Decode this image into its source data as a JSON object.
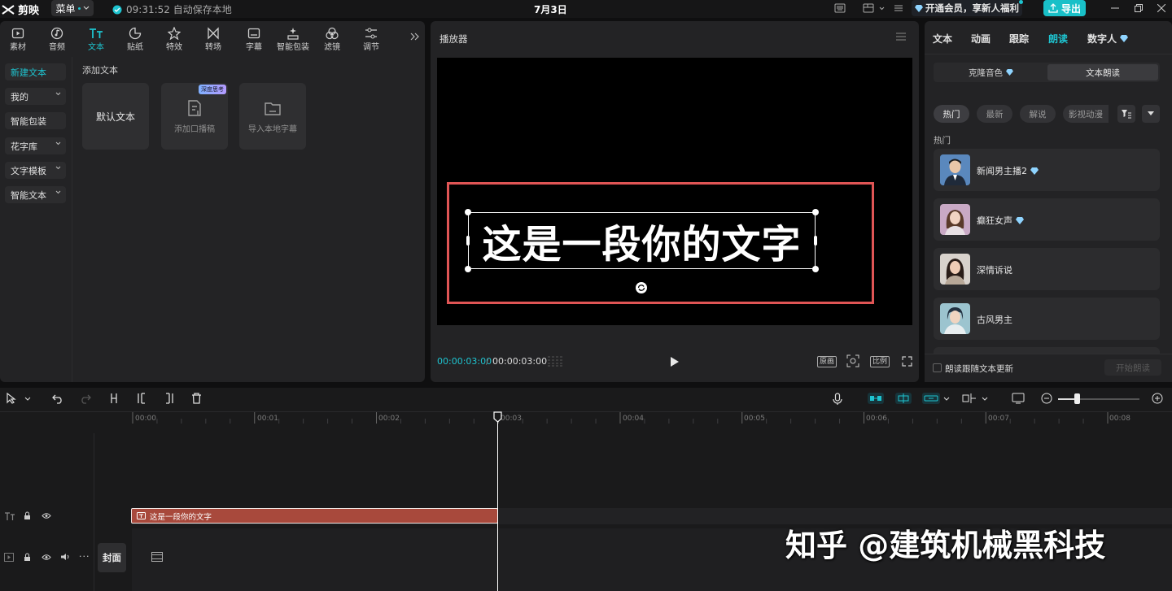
{
  "titlebar": {
    "app": "剪映",
    "menu": "菜单",
    "autosave": "09:31:52 自动保存本地",
    "date": "7月3日",
    "vip": "开通会员，享新人福利",
    "export": "导出"
  },
  "toolbar": {
    "tabs": [
      {
        "label": "素材",
        "icon": "media-icon"
      },
      {
        "label": "音频",
        "icon": "audio-icon"
      },
      {
        "label": "文本",
        "icon": "text-icon"
      },
      {
        "label": "贴纸",
        "icon": "sticker-icon"
      },
      {
        "label": "特效",
        "icon": "effects-icon"
      },
      {
        "label": "转场",
        "icon": "transition-icon"
      },
      {
        "label": "字幕",
        "icon": "subtitle-icon"
      },
      {
        "label": "智能包装",
        "icon": "smart-pack-icon"
      },
      {
        "label": "滤镜",
        "icon": "filter-icon"
      },
      {
        "label": "调节",
        "icon": "adjust-icon"
      }
    ]
  },
  "leftnav": {
    "items": [
      "新建文本",
      "我的",
      "智能包装",
      "花字库",
      "文字模板",
      "智能文本"
    ]
  },
  "textpanel": {
    "heading": "添加文本",
    "cards": [
      "默认文本",
      "添加口播稿",
      "导入本地字幕"
    ],
    "badge": "深度思考"
  },
  "player": {
    "title": "播放器",
    "overlay_text": "这是一段你的文字",
    "time_current": "00:00:03:00",
    "time_total": "00:00:03:00",
    "btn_original": "原画",
    "btn_ratio": "比例"
  },
  "rightpanel": {
    "tabs": [
      "文本",
      "动画",
      "跟踪",
      "朗读",
      "数字人"
    ],
    "active_tab": "朗读",
    "subtabs": [
      "克隆音色",
      "文本朗读"
    ],
    "chips": [
      "热门",
      "最新",
      "解说",
      "影视动漫"
    ],
    "section": "热门",
    "voices": [
      {
        "name": "新闻男主播2",
        "vip": true
      },
      {
        "name": "癫狂女声",
        "vip": true
      },
      {
        "name": "深情诉说",
        "vip": false
      },
      {
        "name": "古风男主",
        "vip": false
      }
    ],
    "follow_label": "朗读跟随文本更新",
    "start_label": "开始朗读"
  },
  "timeline": {
    "ticks": [
      "00:00",
      "00:01",
      "00:02",
      "00:03",
      "00:04",
      "00:05",
      "00:06",
      "00:07",
      "00:08"
    ],
    "clip_label": "这是一段你的文字",
    "cover_label": "封面"
  },
  "watermark": "知乎 @建筑机械黑科技",
  "colors": {
    "accent": "#1ec4d0",
    "clip": "#a8493c",
    "selection": "#e05555"
  }
}
